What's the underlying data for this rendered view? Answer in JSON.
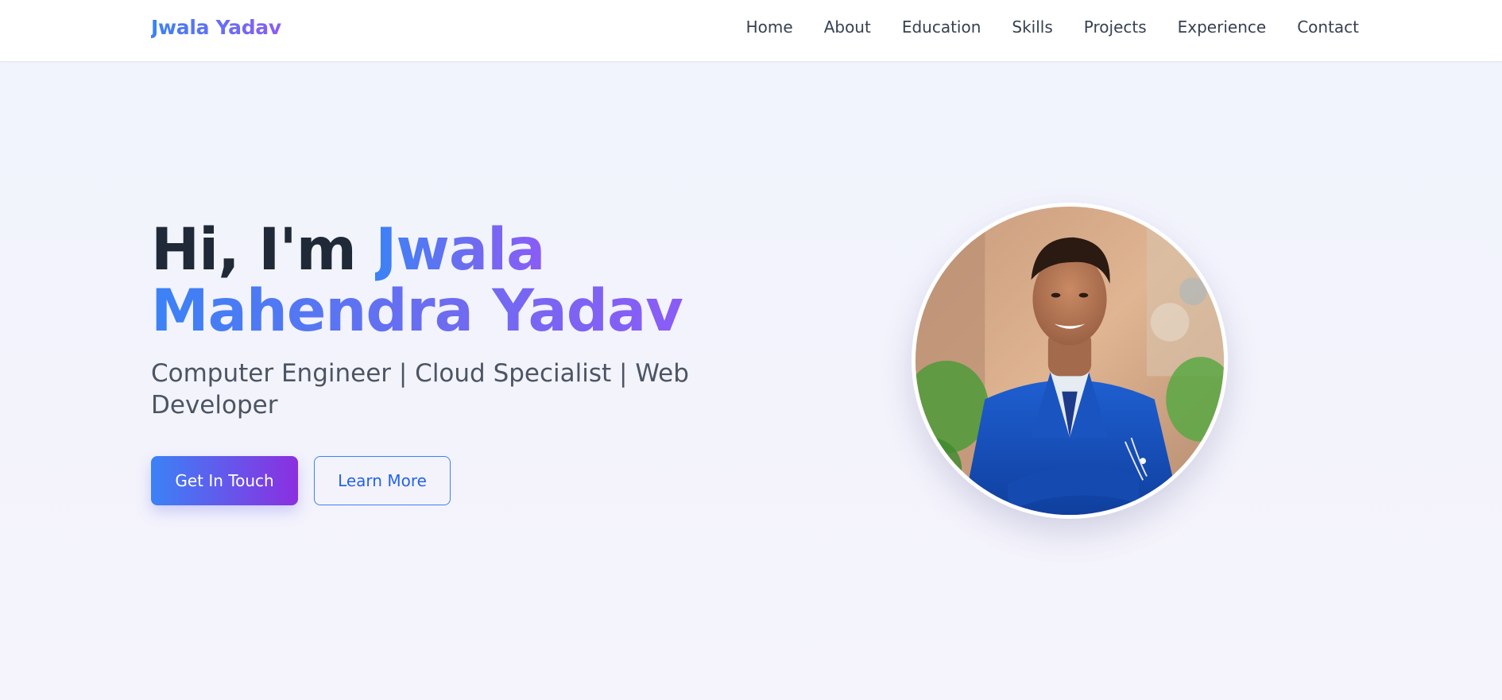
{
  "brand": "Jwala Yadav",
  "nav": {
    "items": [
      {
        "label": "Home"
      },
      {
        "label": "About"
      },
      {
        "label": "Education"
      },
      {
        "label": "Skills"
      },
      {
        "label": "Projects"
      },
      {
        "label": "Experience"
      },
      {
        "label": "Contact"
      }
    ]
  },
  "hero": {
    "greeting": "Hi, I'm",
    "name_first": "Jwala",
    "name_rest": "Mahendra Yadav",
    "subtitle": "Computer Engineer | Cloud Specialist | Web Developer",
    "primary_cta": "Get In Touch",
    "secondary_cta": "Learn More"
  },
  "colors": {
    "accent_blue": "#3b82f6",
    "accent_purple": "#8b5cf6",
    "text_dark": "#1f2937",
    "text_muted": "#4b5563"
  },
  "icons": {
    "profile": "profile-photo-portrait"
  }
}
